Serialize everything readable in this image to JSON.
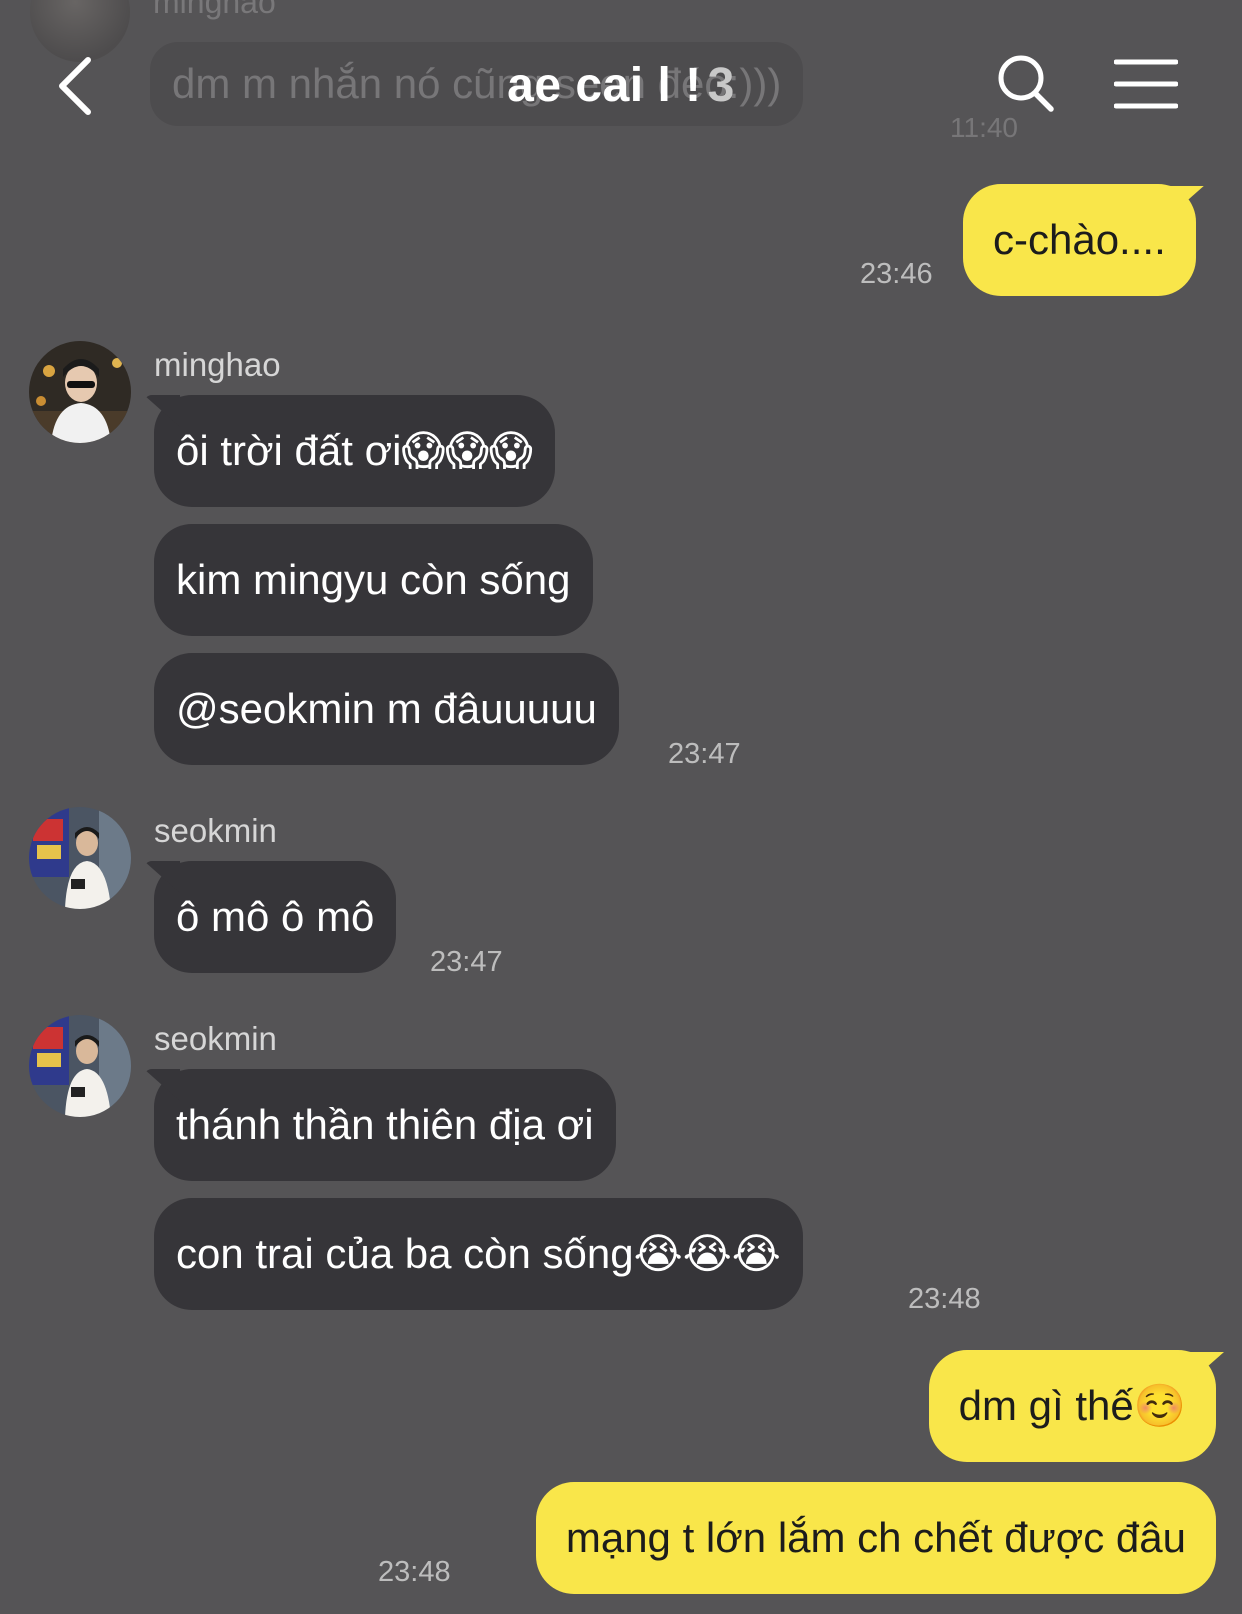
{
  "header": {
    "title": "ae cai l !",
    "member_count": "3",
    "behind": {
      "sender": "minghao",
      "message": "dm m nhắn nó cũng seen đéo:)))",
      "time": "11:40"
    }
  },
  "messages": {
    "m1": {
      "text": "c-chào....",
      "time": "23:46"
    },
    "g1": {
      "sender": "minghao",
      "lines": [
        "ôi trời đất ơi😱😱😱",
        "kim mingyu còn sống",
        "@seokmin m đâuuuuu"
      ],
      "time": "23:47"
    },
    "g2": {
      "sender": "seokmin",
      "lines": [
        "ô mô ô mô"
      ],
      "time": "23:47"
    },
    "g3": {
      "sender": "seokmin",
      "lines": [
        "thánh thần thiên địa ơi",
        "con trai của ba còn sống😭😭😭"
      ],
      "time": "23:48"
    },
    "m2": {
      "lines": [
        "dm gì thế☺️",
        "mạng t lớn lắm ch chết được đâu"
      ],
      "time": "23:48"
    }
  },
  "colors": {
    "background": "#555456",
    "incoming_bubble": "#363539",
    "outgoing_bubble": "#f9e64a"
  },
  "icons": [
    "back-icon",
    "search-icon",
    "menu-icon"
  ]
}
